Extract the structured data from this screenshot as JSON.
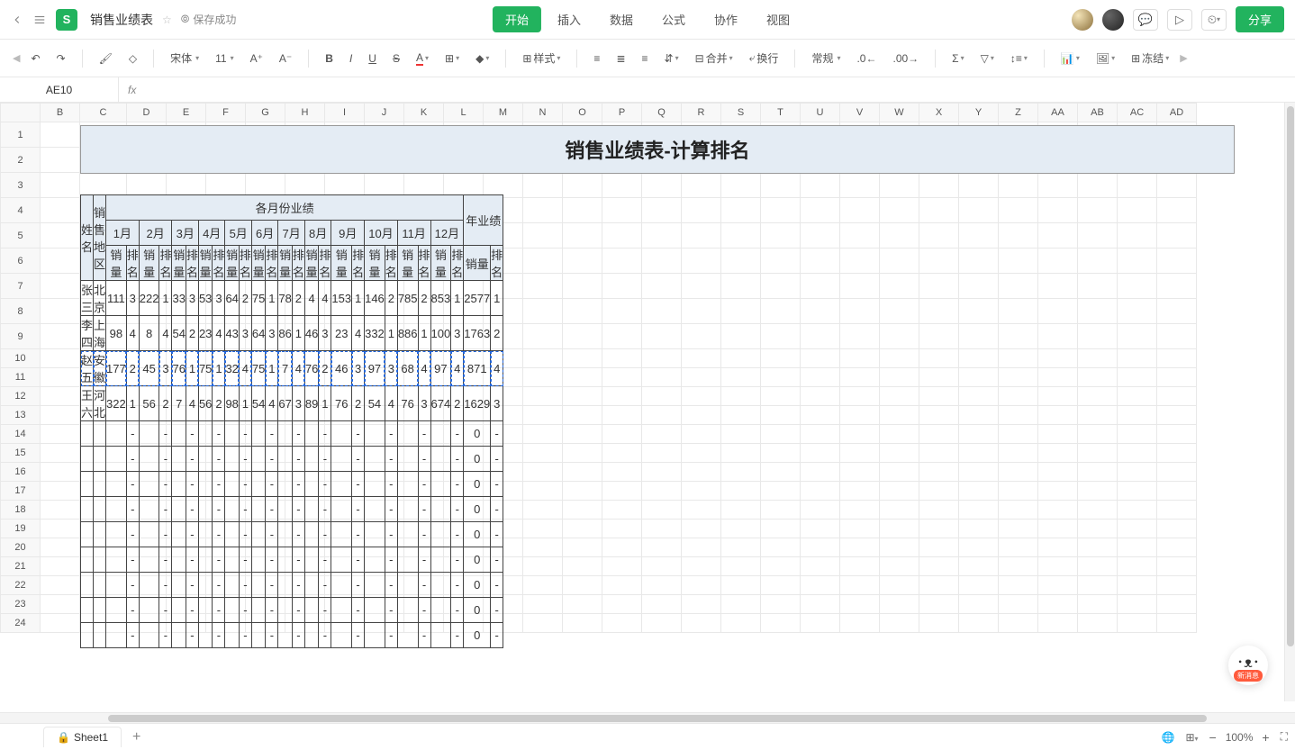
{
  "header": {
    "doc_title": "销售业绩表",
    "save_status": "保存成功",
    "menu_tabs": [
      "开始",
      "插入",
      "数据",
      "公式",
      "协作",
      "视图"
    ],
    "active_tab_index": 0,
    "share_label": "分享"
  },
  "toolbar": {
    "font_family": "宋体",
    "font_size": "11",
    "style_label": "样式",
    "merge_label": "合并",
    "wrap_label": "换行",
    "number_format": "常规",
    "freeze_label": "冻结"
  },
  "formula_bar": {
    "cell_ref": "AE10",
    "fx": "fx",
    "value": ""
  },
  "columns": [
    "B",
    "C",
    "D",
    "E",
    "F",
    "G",
    "H",
    "I",
    "J",
    "K",
    "L",
    "M",
    "N",
    "O",
    "P",
    "Q",
    "R",
    "S",
    "T",
    "U",
    "V",
    "W",
    "X",
    "Y",
    "Z",
    "AA",
    "AB",
    "AC",
    "AD"
  ],
  "row_numbers": [
    1,
    2,
    3,
    4,
    5,
    6,
    7,
    8,
    9,
    10,
    11,
    12,
    13,
    14,
    15,
    16,
    17,
    18,
    19,
    20,
    21,
    22,
    23,
    24
  ],
  "chart_data": {
    "type": "table",
    "title": "销售业绩表-计算排名",
    "headers": {
      "name": "姓名",
      "region": "销售地区",
      "month_section": "各月份业绩",
      "year_section": "年业绩",
      "months": [
        "1月",
        "2月",
        "3月",
        "4月",
        "5月",
        "6月",
        "7月",
        "8月",
        "9月",
        "10月",
        "11月",
        "12月"
      ],
      "sub": {
        "sales": "销量",
        "rank": "排名"
      }
    },
    "rows": [
      {
        "name": "张三",
        "region": "北京",
        "months": [
          [
            111,
            3
          ],
          [
            222,
            1
          ],
          [
            33,
            3
          ],
          [
            53,
            3
          ],
          [
            64,
            2
          ],
          [
            75,
            1
          ],
          [
            78,
            2
          ],
          [
            4,
            4
          ],
          [
            153,
            1
          ],
          [
            146,
            2
          ],
          [
            785,
            2
          ],
          [
            853,
            1
          ]
        ],
        "year": [
          2577,
          1
        ]
      },
      {
        "name": "李四",
        "region": "上海",
        "months": [
          [
            98,
            4
          ],
          [
            8,
            4
          ],
          [
            54,
            2
          ],
          [
            23,
            4
          ],
          [
            43,
            3
          ],
          [
            64,
            3
          ],
          [
            86,
            1
          ],
          [
            46,
            3
          ],
          [
            23,
            4
          ],
          [
            332,
            1
          ],
          [
            886,
            1
          ],
          [
            100,
            3
          ]
        ],
        "year": [
          1763,
          2
        ]
      },
      {
        "name": "赵五",
        "region": "安徽",
        "months": [
          [
            177,
            2
          ],
          [
            45,
            3
          ],
          [
            76,
            1
          ],
          [
            75,
            1
          ],
          [
            32,
            4
          ],
          [
            75,
            1
          ],
          [
            7,
            4
          ],
          [
            76,
            2
          ],
          [
            46,
            3
          ],
          [
            97,
            3
          ],
          [
            68,
            4
          ],
          [
            97,
            4
          ]
        ],
        "year": [
          871,
          4
        ]
      },
      {
        "name": "王六",
        "region": "河北",
        "months": [
          [
            322,
            1
          ],
          [
            56,
            2
          ],
          [
            7,
            4
          ],
          [
            56,
            2
          ],
          [
            98,
            1
          ],
          [
            54,
            4
          ],
          [
            67,
            3
          ],
          [
            89,
            1
          ],
          [
            76,
            2
          ],
          [
            54,
            4
          ],
          [
            76,
            3
          ],
          [
            674,
            2
          ]
        ],
        "year": [
          1629,
          3
        ]
      }
    ],
    "empty_rows": 9,
    "selected_row_index": 2
  },
  "footer": {
    "sheet_name": "Sheet1",
    "zoom": "100%"
  },
  "helper": {
    "tag": "新消息"
  }
}
